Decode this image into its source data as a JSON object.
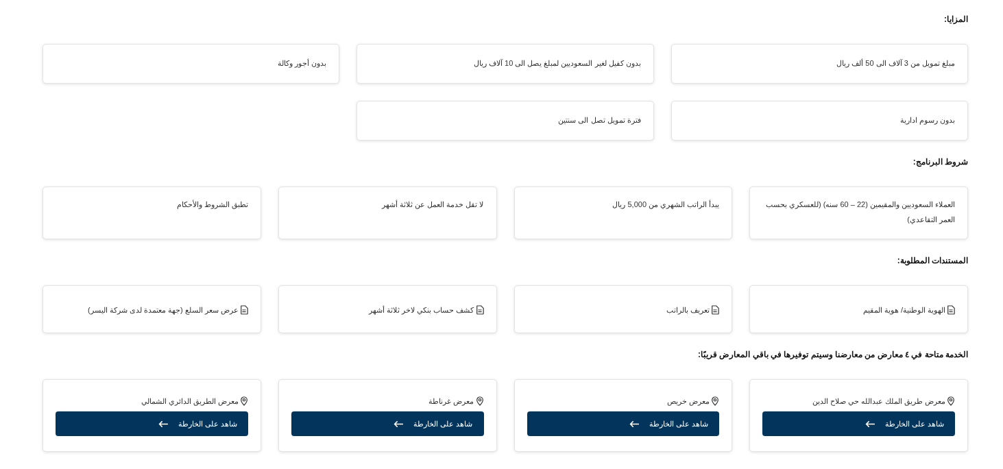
{
  "sections": [
    {
      "title": "المزايا:",
      "kind": "benefits",
      "items": [
        {
          "text": "مبلغ تمويل من 3 آلاف الى 50 ألف ريال"
        },
        {
          "text": "بدون كفيل لغير السعوديين لمبلغ يصل الى 10 آلاف ريال"
        },
        {
          "text": "بدون أجور وكالة"
        },
        {
          "text": "بدون رسوم ادارية"
        },
        {
          "text": "فترة تمويل تصل الى سنتين"
        }
      ]
    },
    {
      "title": "شروط البرنامج:",
      "kind": "conditions",
      "items": [
        {
          "text": "العملاء السعوديين والمقيمين (22 – 60 سنه) (للعسكري بحسب العمر التقاعدي)"
        },
        {
          "text": "يبدأ الراتب الشهري من 5,000 ريال"
        },
        {
          "text": "لا تقل خدمة العمل عن ثلاثة أشهر"
        },
        {
          "text": "تطبق الشروط والأحكام"
        }
      ]
    },
    {
      "title": "المستندات المطلوبة:",
      "kind": "documents",
      "items": [
        {
          "text": "الهوية الوطنية/ هوية المقيم"
        },
        {
          "text": "تعريف بالراتب"
        },
        {
          "text": "كشف حساب بنكي لاخر ثلاثة أشهر"
        },
        {
          "text": "عرض سعر السلع (جهة معتمدة لدى شركة اليسر)"
        }
      ]
    },
    {
      "title": "الخدمة متاحة في ٤ معارض من معارضنا وسيتم توفيرها في باقي المعارض قريبًا:",
      "kind": "showrooms",
      "items": [
        {
          "text": "معرض طريق الملك عبدالله حي صلاح الدين",
          "button": "شاهد على الخارطة"
        },
        {
          "text": "معرض خريص",
          "button": "شاهد على الخارطة"
        },
        {
          "text": "معرض غرناطة",
          "button": "شاهد على الخارطة"
        },
        {
          "text": "معرض الطريق الدائري الشمالي",
          "button": "شاهد على الخارطة"
        }
      ]
    }
  ]
}
